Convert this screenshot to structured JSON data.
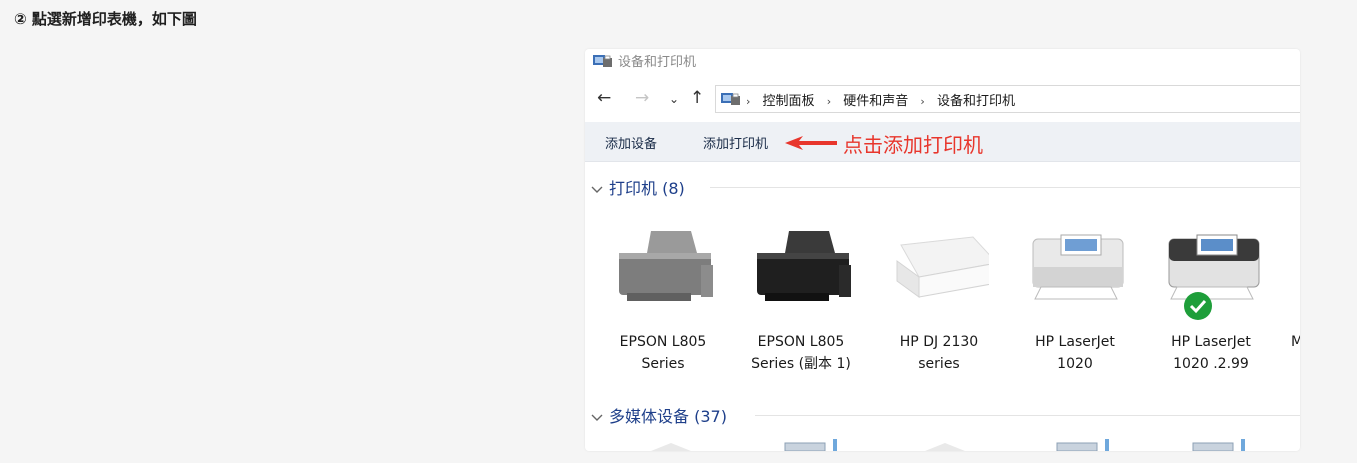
{
  "heading": "② 點選新增印表機，如下圖",
  "window": {
    "title": "设备和打印机",
    "nav": {
      "back": "←",
      "forward": "→",
      "recent": "⌄",
      "up": "↑"
    },
    "breadcrumb": [
      "控制面板",
      "硬件和声音",
      "设备和打印机"
    ],
    "breadcrumb_sep": "›"
  },
  "toolbar": {
    "add_device": "添加设备",
    "add_printer": "添加打印机",
    "annotation": "点击添加打印机"
  },
  "groups": {
    "printers": {
      "label": "打印机 (8)"
    },
    "multimedia": {
      "label": "多媒体设备 (37)"
    }
  },
  "printers": [
    {
      "line1": "EPSON L805",
      "line2": "Series",
      "style": "gray"
    },
    {
      "line1": "EPSON L805",
      "line2": "Series (副本 1)",
      "style": "black"
    },
    {
      "line1": "HP DJ 2130",
      "line2": "series",
      "style": "white"
    },
    {
      "line1": "HP LaserJet",
      "line2": "1020",
      "style": "laser"
    },
    {
      "line1": "HP LaserJet",
      "line2": "1020 .2.99",
      "style": "laser-dark",
      "default": true
    },
    {
      "line1": "M",
      "line2": "",
      "style": "partial"
    }
  ],
  "colors": {
    "annotation": "#e8362c",
    "group_header": "#1e3f8a",
    "toolbar_bg": "#eef1f5",
    "default_badge": "#1e9e3a"
  }
}
